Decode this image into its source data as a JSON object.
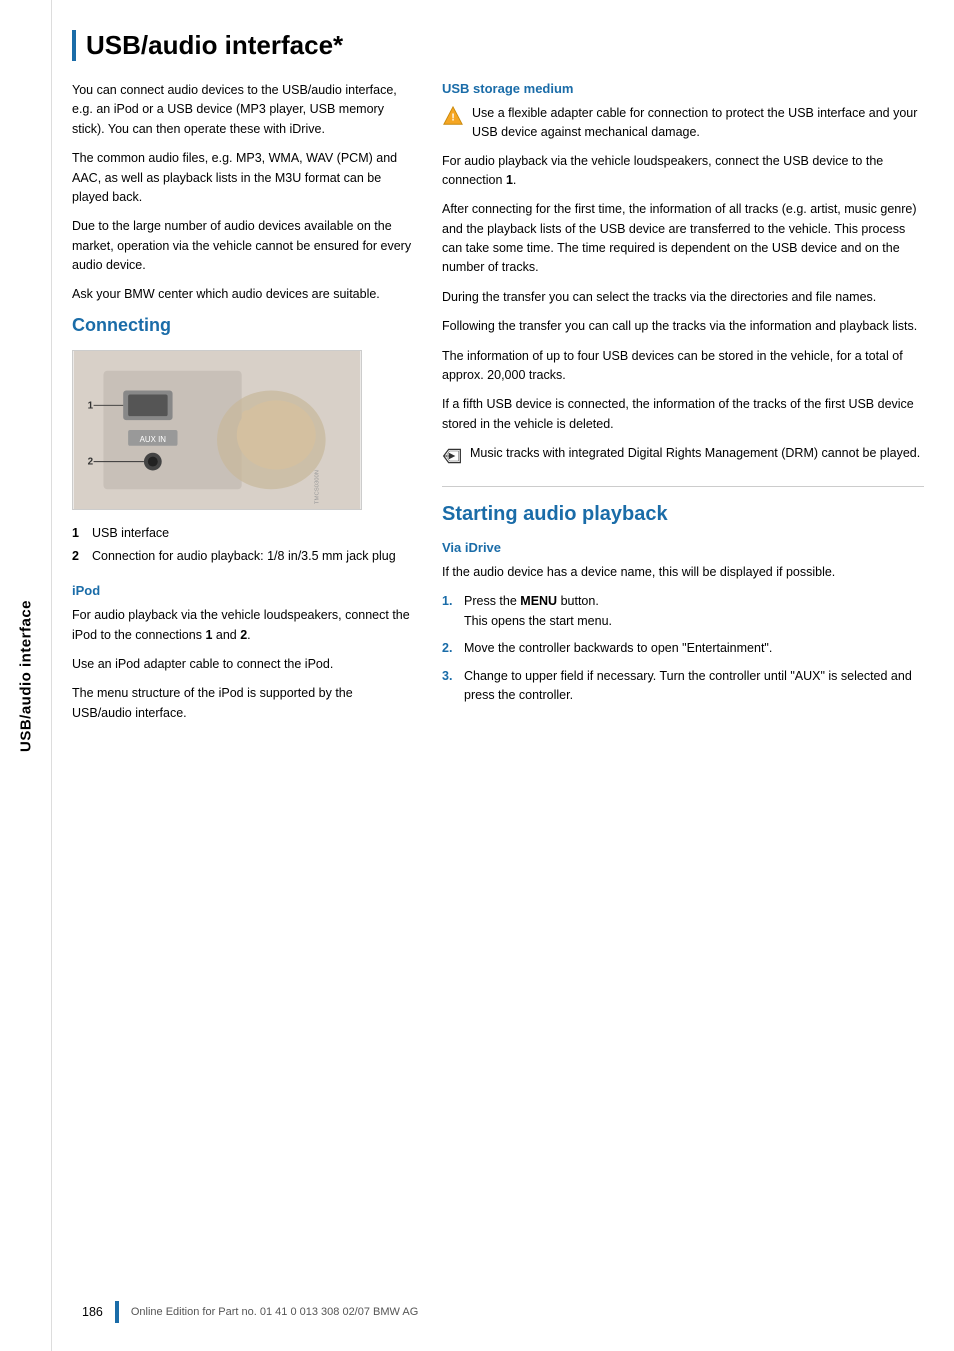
{
  "sidebar": {
    "label": "USB/audio interface"
  },
  "page_title": "USB/audio interface*",
  "left_col": {
    "intro_paragraphs": [
      "You can connect audio devices to the USB/audio interface, e.g. an iPod or a USB device (MP3 player, USB memory stick). You can then operate these with iDrive.",
      "The common audio files, e.g. MP3, WMA, WAV (PCM) and AAC, as well as playback lists in the M3U format can be played back.",
      "Due to the large number of audio devices available on the market, operation via the vehicle cannot be ensured for every audio device.",
      "Ask your BMW center which audio devices are suitable."
    ],
    "connecting_heading": "Connecting",
    "connector_labels": [
      {
        "num": "1",
        "text": "USB interface"
      },
      {
        "num": "2",
        "text": "Connection for audio playback: 1/8 in/3.5 mm jack plug"
      }
    ],
    "ipod_heading": "iPod",
    "ipod_paragraphs": [
      "For audio playback via the vehicle loudspeakers, connect the iPod to the connections 1 and 2.",
      "Use an iPod adapter cable to connect the iPod.",
      "The menu structure of the iPod is supported by the USB/audio interface."
    ]
  },
  "right_col": {
    "usb_storage_heading": "USB storage medium",
    "warning_text": "Use a flexible adapter cable for connection to protect the USB interface and your USB device against mechanical damage.",
    "usb_paragraphs": [
      "For audio playback via the vehicle loudspeakers, connect the USB device to the connection 1.",
      "After connecting for the first time, the information of all tracks (e.g. artist, music genre) and the playback lists of the USB device are transferred to the vehicle. This process can take some time. The time required is dependent on the USB device and on the number of tracks.",
      "During the transfer you can select the tracks via the directories and file names.",
      "Following the transfer you can call up the tracks via the information and playback lists.",
      "The information of up to four USB devices can be stored in the vehicle, for a total of approx. 20,000 tracks.",
      "If a fifth USB device is connected, the information of the tracks of the first USB device stored in the vehicle is deleted."
    ],
    "drm_note": "Music tracks with integrated Digital Rights Management (DRM) cannot be played.",
    "audio_playback_heading": "Starting audio playback",
    "via_idrive_heading": "Via iDrive",
    "via_idrive_intro": "If the audio device has a device name, this will be displayed if possible.",
    "steps": [
      {
        "num": "1.",
        "text_before": "Press the ",
        "bold": "MENU",
        "text_after": " button.",
        "sub": "This opens the start menu."
      },
      {
        "num": "2.",
        "text": "Move the controller backwards to open \"Entertainment\"."
      },
      {
        "num": "3.",
        "text": "Change to upper field if necessary. Turn the controller until \"AUX\" is selected and press the controller."
      }
    ]
  },
  "footer": {
    "page_num": "186",
    "text": "Online Edition for Part no. 01 41 0 013 308 02/07 BMW AG"
  }
}
